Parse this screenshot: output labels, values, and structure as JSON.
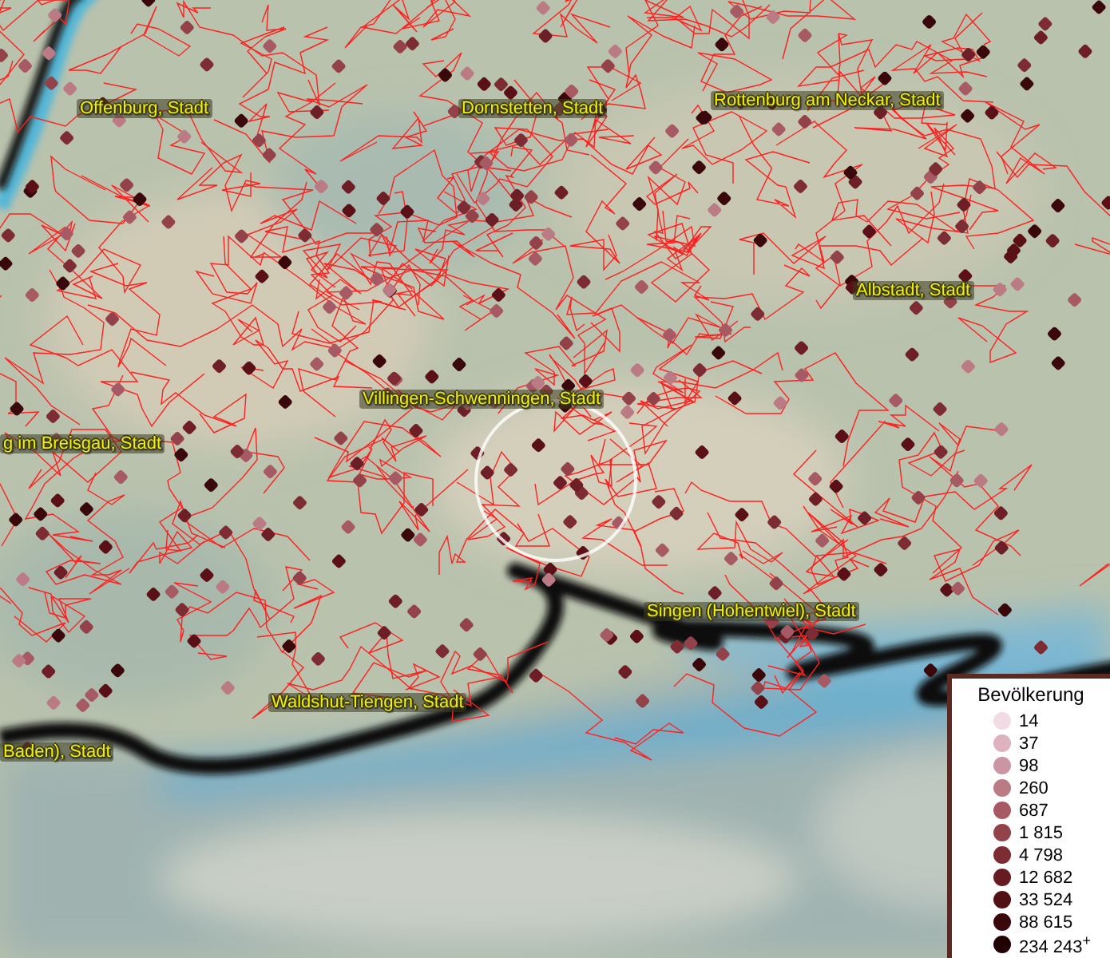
{
  "map": {
    "place_labels": [
      {
        "text": "Offenburg, Stadt"
      },
      {
        "text": "Dornstetten, Stadt"
      },
      {
        "text": "Rottenburg am Neckar, Stadt"
      },
      {
        "text": "Albstadt, Stadt"
      },
      {
        "text": "Villingen-Schwenningen, Stadt"
      },
      {
        "text": "g im Breisgau, Stadt"
      },
      {
        "text": "Singen (Hohentwiel), Stadt"
      },
      {
        "text": "Waldshut-Tiengen, Stadt"
      },
      {
        "text": "Baden), Stadt"
      }
    ]
  },
  "legend": {
    "title": "Bevölkerung",
    "items": [
      {
        "label": "14",
        "color": "#f3dbe6"
      },
      {
        "label": "37",
        "color": "#dfb2c0"
      },
      {
        "label": "98",
        "color": "#cc95a3"
      },
      {
        "label": "260",
        "color": "#bb7b85"
      },
      {
        "label": "687",
        "color": "#a85a64"
      },
      {
        "label": "1 815",
        "color": "#944249"
      },
      {
        "label": "4 798",
        "color": "#7d2c33"
      },
      {
        "label": "12 682",
        "color": "#681a21"
      },
      {
        "label": "33 524",
        "color": "#521014"
      },
      {
        "label": "88 615",
        "color": "#3a070a"
      },
      {
        "label": "234 243$^{+}$",
        "color": "#220204"
      }
    ]
  }
}
